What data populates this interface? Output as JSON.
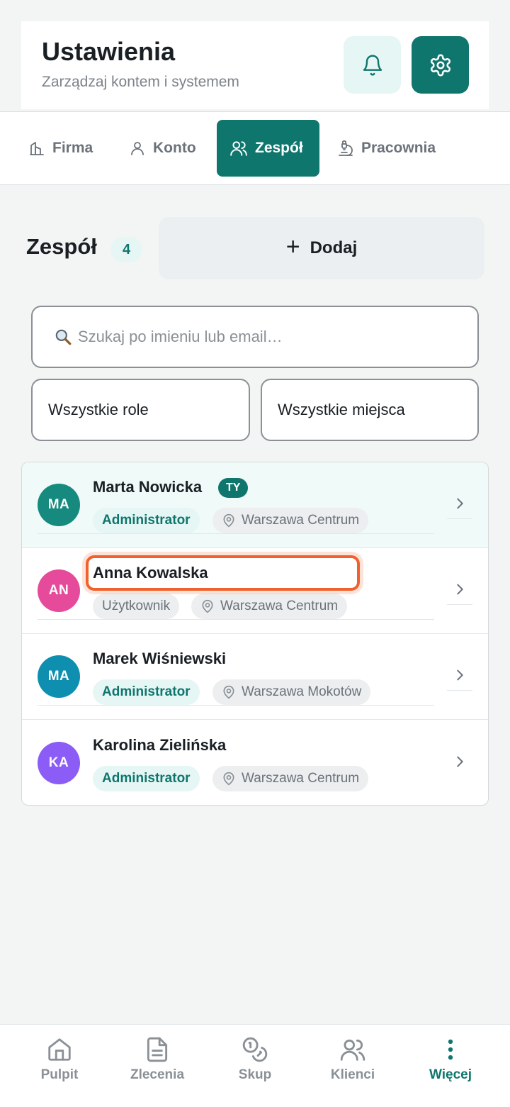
{
  "header": {
    "title": "Ustawienia",
    "subtitle": "Zarządzaj kontem i systemem",
    "icons": {
      "notifications": "bell-icon",
      "settings": "gear-icon"
    }
  },
  "tabs": [
    {
      "label": "Firma",
      "icon": "building-icon",
      "active": false
    },
    {
      "label": "Konto",
      "icon": "user-icon",
      "active": false
    },
    {
      "label": "Zespół",
      "icon": "users-icon",
      "active": true
    },
    {
      "label": "Pracownia",
      "icon": "workshop-icon",
      "active": false
    }
  ],
  "team": {
    "title": "Zespół",
    "count": "4",
    "add_label": "Dodaj",
    "search_placeholder": "Szukaj po imieniu lub email…",
    "filter_roles": "Wszystkie role",
    "filter_places": "Wszystkie miejsca",
    "members": [
      {
        "initials": "MA",
        "name": "Marta Nowicka",
        "badge": "TY",
        "role": "Administrator",
        "location": "Warszawa Centrum",
        "avatar_color": "#168a7e"
      },
      {
        "initials": "AN",
        "name": "Anna Kowalska",
        "role": "Użytkownik",
        "location": "Warszawa Centrum",
        "avatar_color": "#e64a9a"
      },
      {
        "initials": "MA",
        "name": "Marek Wiśniewski",
        "role": "Administrator",
        "location": "Warszawa Mokotów",
        "avatar_color": "#0e8fb0"
      },
      {
        "initials": "KA",
        "name": "Karolina Zielińska",
        "role": "Administrator",
        "location": "Warszawa Centrum",
        "avatar_color": "#8b5cf6"
      }
    ]
  },
  "bottom_nav": [
    {
      "label": "Pulpit",
      "icon": "home-icon",
      "active": false
    },
    {
      "label": "Zlecenia",
      "icon": "document-icon",
      "active": false
    },
    {
      "label": "Skup",
      "icon": "coins-icon",
      "active": false
    },
    {
      "label": "Klienci",
      "icon": "users-icon",
      "active": false
    },
    {
      "label": "Więcej",
      "icon": "more-vertical-icon",
      "active": true
    }
  ],
  "colors": {
    "accent": "#0f766e",
    "accent_light": "#e6f6f4",
    "highlight": "#f0622d"
  }
}
